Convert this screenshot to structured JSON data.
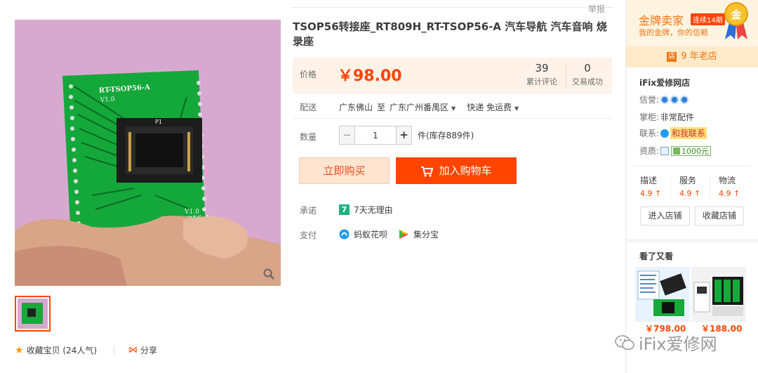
{
  "report_label": "举报",
  "product": {
    "title": "TSOP56转接座_RT809H_RT-TSOP56-A 汽车导航 汽车音响 烧录座",
    "price_label": "价格",
    "price": "￥98.00",
    "reviews_count": "39",
    "reviews_label": "累计评论",
    "sales_count": "0",
    "sales_label": "交易成功",
    "board_top_label": "RT-TSOP56-A",
    "board_top_ver": "V1.0",
    "board_bottom_ver": "V1.0",
    "board_bottom_label": "RT-TSOP56-A",
    "board_pin_label": "P1"
  },
  "shipping": {
    "label": "配送",
    "from": "广东佛山",
    "to_word": "至",
    "to": "广东广州番禺区",
    "method": "快递 免运费"
  },
  "quantity": {
    "label": "数量",
    "value": "1",
    "minus": "−",
    "plus": "+",
    "stock": "件(库存889件)"
  },
  "actions": {
    "buy_now": "立即购买",
    "add_cart": "加入购物车"
  },
  "promise": {
    "label": "承诺",
    "badge": "7",
    "text": "7天无理由"
  },
  "payment": {
    "label": "支付",
    "methods": [
      "蚂蚁花呗",
      "集分宝"
    ]
  },
  "favorite": {
    "label": "收藏宝贝 (24人气)",
    "share": "分享"
  },
  "seller": {
    "gold_title": "金牌卖家",
    "gold_badge": "连续14期",
    "gold_sub": "我的金牌，你的信赖",
    "medal_char": "金",
    "age_icon": "店",
    "shop_age": "9 年老店",
    "shop_name": "iFix爱修网店",
    "credit_label": "信誉:",
    "keeper_label": "掌柜:",
    "keeper": "非常配件",
    "contact_label": "联系:",
    "contact_text": "和我联系",
    "qual_label": "资质:",
    "deposit": "1000元",
    "dsr": [
      {
        "k": "描述",
        "v": "4.9 ↑"
      },
      {
        "k": "服务",
        "v": "4.9 ↑"
      },
      {
        "k": "物流",
        "v": "4.9 ↑"
      }
    ],
    "enter_shop": "进入店铺",
    "fav_shop": "收藏店铺"
  },
  "seen": {
    "title": "看了又看",
    "items": [
      {
        "price": "￥798.00"
      },
      {
        "price": "￥188.00"
      }
    ]
  },
  "watermark": "iFix爱修网",
  "colors": {
    "accent": "#ff4400",
    "price_bg": "#fff2e8",
    "seller_bg": "#fff4e2",
    "gold": "#f07712"
  }
}
